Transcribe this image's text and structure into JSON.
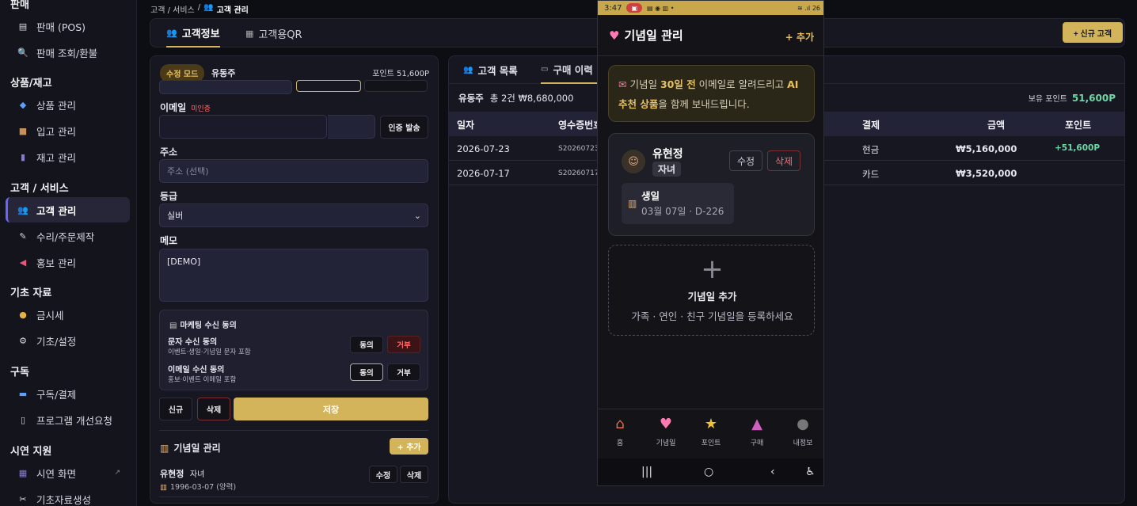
{
  "sidebar": {
    "sections": [
      {
        "title": "판매"
      },
      {
        "title": "상품/재고"
      },
      {
        "title": "고객 / 서비스"
      },
      {
        "title": "기초 자료"
      },
      {
        "title": "구독"
      },
      {
        "title": "시연 지원"
      }
    ],
    "items": [
      {
        "label": "판매 (POS)",
        "icon": "cash-register-icon"
      },
      {
        "label": "판매 조회/환불",
        "icon": "search-icon"
      },
      {
        "label": "상품 관리",
        "icon": "diamond-icon"
      },
      {
        "label": "입고 관리",
        "icon": "box-icon"
      },
      {
        "label": "재고 관리",
        "icon": "stock-icon"
      },
      {
        "label": "고객 관리",
        "icon": "users-icon"
      },
      {
        "label": "수리/주문제작",
        "icon": "wrench-icon"
      },
      {
        "label": "홍보 관리",
        "icon": "megaphone-icon"
      },
      {
        "label": "금시세",
        "icon": "medal-icon"
      },
      {
        "label": "기초/설정",
        "icon": "gear-icon"
      },
      {
        "label": "구독/결제",
        "icon": "card-icon"
      },
      {
        "label": "프로그램 개선요청",
        "icon": "document-icon"
      },
      {
        "label": "시연 화면",
        "icon": "display-icon"
      },
      {
        "label": "기초자료생성",
        "icon": "tools-icon"
      }
    ]
  },
  "breadcrumb": {
    "parent": "고객 / 서비스",
    "sep": "/",
    "current": "고객 관리"
  },
  "tabs": [
    {
      "label": "고객정보"
    },
    {
      "label": "고객용QR"
    }
  ],
  "new_customer_label": "+ 신규 고객",
  "form": {
    "edit_badge": "수정 모드",
    "customer_name": "유동주",
    "points": "포인트 51,600P",
    "email_label": "이메일",
    "email_warn": "미인증",
    "verify_btn": "인증 발송",
    "address_label": "주소",
    "address_placeholder": "주소 (선택)",
    "grade_label": "등급",
    "grade_value": "실버",
    "memo_label": "메모",
    "memo_value": "[DEMO]",
    "consent_title": "마케팅 수신 동의",
    "sms_title": "문자 수신 동의",
    "sms_sub": "이벤트·생일·기념일 문자 포함",
    "email_consent_title": "이메일 수신 동의",
    "email_consent_sub": "홍보·이벤트 이메일 포함",
    "agree": "동의",
    "reject": "거부",
    "new_btn": "신규",
    "delete_btn": "삭제",
    "save_btn": "저장",
    "anniv_title": "기념일 관리",
    "anniv_add": "+ 추가",
    "anniv_person": "유현정",
    "anniv_rel": "자녀",
    "anniv_date": "1996-03-07 (양력)",
    "anniv_edit": "수정",
    "anniv_delete": "삭제"
  },
  "table": {
    "tabs": [
      {
        "label": "고객 목록"
      },
      {
        "label": "구매 이력"
      }
    ],
    "summary_name": "유동주",
    "summary_text": "총 2건 ₩8,680,000",
    "hold_points_label": "보유 포인트",
    "hold_points_value": "51,600P",
    "columns": [
      "일자",
      "영수증번호",
      "결제",
      "금액",
      "포인트"
    ],
    "rows": [
      {
        "date": "2026-07-23",
        "receipt": "S20260723-",
        "pay": "현금",
        "amount": "₩5,160,000",
        "points": "+51,600P"
      },
      {
        "date": "2026-07-17",
        "receipt": "S20260717-",
        "pay": "카드",
        "amount": "₩3,520,000",
        "points": ""
      }
    ]
  },
  "phone": {
    "time": "3:47",
    "battery": "26",
    "title": "기념일 관리",
    "add": "+ 추가",
    "notice_pre": "기념일 ",
    "notice_hl1": "30일 전",
    "notice_mid": " 이메일로 알려드리고 ",
    "notice_hl2": "AI 추천 상품",
    "notice_post": "을 함께 보내드립니다.",
    "person_name": "유현정",
    "person_rel": "자녀",
    "edit": "수정",
    "delete": "삭제",
    "event_name": "생일",
    "event_date": "03월 07일 · D-226",
    "add_title": "기념일 추가",
    "add_sub": "가족 · 연인 · 친구 기념일을 등록하세요",
    "nav": [
      {
        "label": "홈",
        "icon": "home-icon"
      },
      {
        "label": "기념일",
        "icon": "heart-gift-icon"
      },
      {
        "label": "포인트",
        "icon": "star-icon"
      },
      {
        "label": "구매",
        "icon": "shopping-bag-icon"
      },
      {
        "label": "내정보",
        "icon": "profile-icon"
      }
    ]
  },
  "colors": {
    "accent": "#d4b45a",
    "danger": "#ff6a6a",
    "positive": "#6fd6a6",
    "primary": "#6d63ff"
  }
}
